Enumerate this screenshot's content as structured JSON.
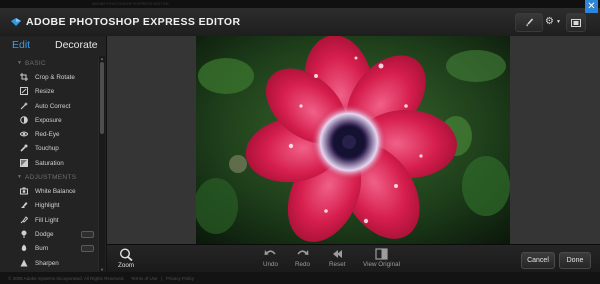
{
  "window": {
    "ghost_title": "ADOBE PHOTOSHOP EXPRESS EDITOR",
    "title": "ADOBE PHOTOSHOP EXPRESS EDITOR",
    "close_glyph": "✕"
  },
  "toolbar": {
    "brush_icon": "brush-icon",
    "gear_icon": "gear-icon",
    "fullscreen_icon": "fullscreen-icon"
  },
  "sidebar": {
    "tabs": [
      {
        "label": "Edit",
        "active": true
      },
      {
        "label": "Decorate",
        "active": false
      }
    ],
    "sections": [
      {
        "label": "BASIC",
        "items": [
          {
            "label": "Crop & Rotate",
            "icon": "crop-icon"
          },
          {
            "label": "Resize",
            "icon": "resize-icon"
          },
          {
            "label": "Auto Correct",
            "icon": "wand-icon"
          },
          {
            "label": "Exposure",
            "icon": "exposure-icon"
          },
          {
            "label": "Red-Eye",
            "icon": "eye-icon"
          },
          {
            "label": "Touchup",
            "icon": "touchup-icon"
          },
          {
            "label": "Saturation",
            "icon": "saturation-icon"
          }
        ]
      },
      {
        "label": "ADJUSTMENTS",
        "items": [
          {
            "label": "White Balance",
            "icon": "white-balance-icon"
          },
          {
            "label": "Highlight",
            "icon": "highlight-icon"
          },
          {
            "label": "Fill Light",
            "icon": "fill-light-icon"
          },
          {
            "label": "Dodge",
            "icon": "dodge-icon",
            "toggle": true
          },
          {
            "label": "Burn",
            "icon": "burn-icon",
            "toggle": true
          },
          {
            "label": "Sharpen",
            "icon": "sharpen-icon"
          }
        ]
      }
    ]
  },
  "bottom": {
    "zoom": {
      "label": "Zoom",
      "icon": "zoom-icon"
    },
    "undo": {
      "label": "Undo",
      "icon": "undo-icon"
    },
    "redo": {
      "label": "Redo",
      "icon": "redo-icon"
    },
    "reset": {
      "label": "Reset",
      "icon": "reset-icon"
    },
    "view_original": {
      "label": "View Original",
      "icon": "view-original-icon"
    },
    "cancel": "Cancel",
    "done": "Done"
  },
  "footer": {
    "copyright": "© 2008 Adobe Systems Incorporated. All Rights Reserved.",
    "terms": "Terms of Use",
    "separator": "|",
    "privacy": "Privacy Policy"
  },
  "colors": {
    "accent": "#3b9be8",
    "flower_red": "#d21c48",
    "leaf_green": "#2f6b2a"
  }
}
